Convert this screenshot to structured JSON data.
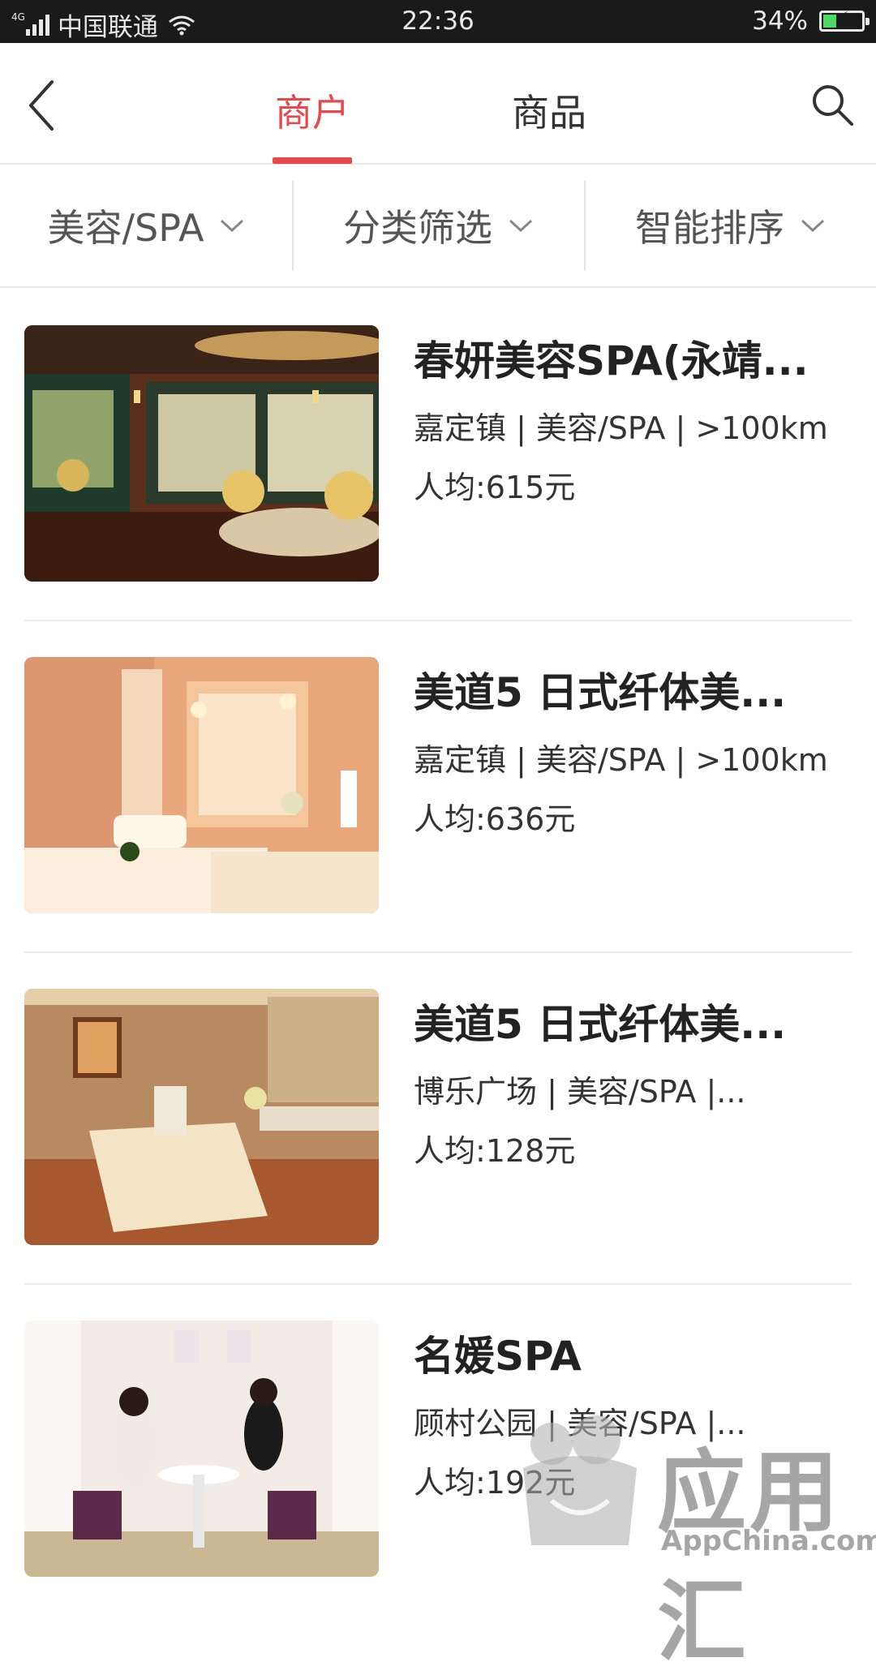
{
  "status_bar": {
    "network": "4G",
    "carrier": "中国联通",
    "time": "22:36",
    "battery": "34%",
    "battery_level": 0.34
  },
  "header": {
    "tabs": [
      {
        "label": "商户",
        "active": true
      },
      {
        "label": "商品",
        "active": false
      }
    ],
    "accent_color": "#e8474c"
  },
  "filters": [
    {
      "label": "美容/SPA"
    },
    {
      "label": "分类筛选"
    },
    {
      "label": "智能排序"
    }
  ],
  "merchants": [
    {
      "title": "春妍美容SPA(永靖...",
      "meta": "嘉定镇 | 美容/SPA | >100km",
      "price": "人均:615元"
    },
    {
      "title": "美道5 日式纤体美...",
      "meta": "嘉定镇 | 美容/SPA | >100km",
      "price": "人均:636元"
    },
    {
      "title": "美道5 日式纤体美...",
      "meta": "博乐广场 | 美容/SPA |...",
      "price": "人均:128元"
    },
    {
      "title": "名媛SPA",
      "meta": "顾村公园 | 美容/SPA |...",
      "price": "人均:192元"
    }
  ],
  "watermark": {
    "text": "应用汇",
    "sub": "AppChina.com"
  }
}
